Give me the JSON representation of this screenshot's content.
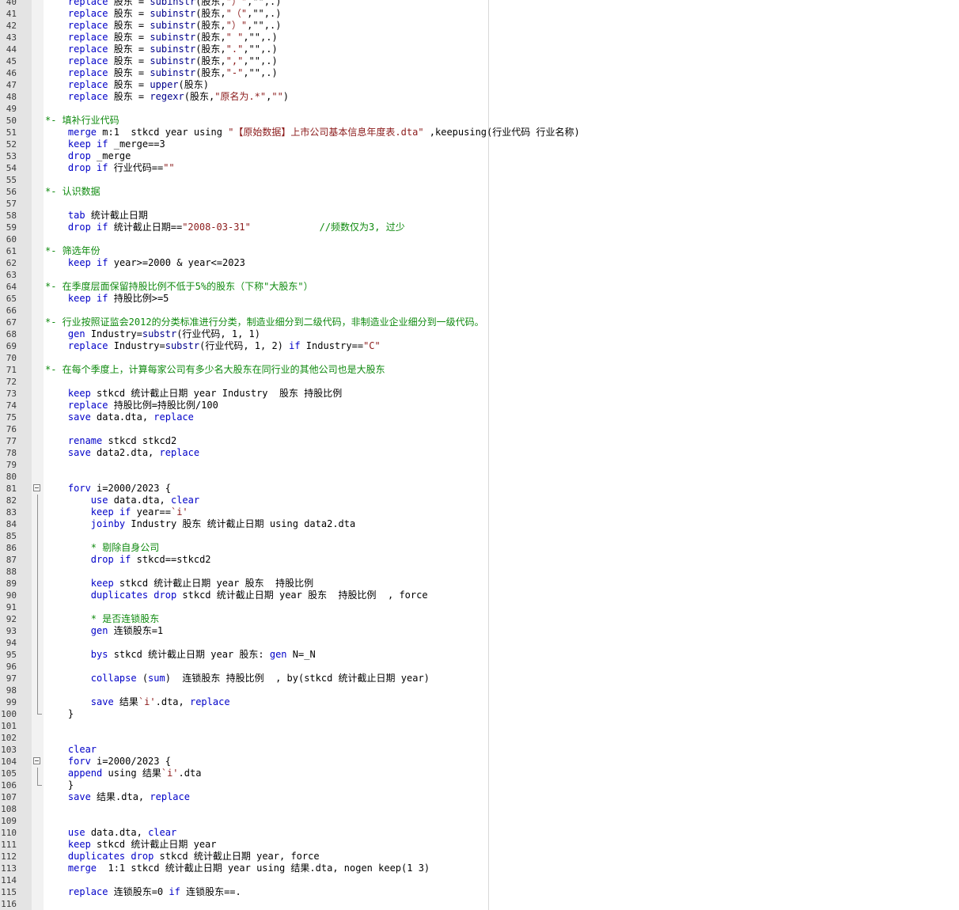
{
  "editor": {
    "colors": {
      "keyword": "#0000c8",
      "string": "#8b1a1a",
      "comment": "#0f8a0f",
      "function": "#00008b",
      "gutter_bg": "#e4e4e4"
    },
    "fold_markers": [
      81,
      104
    ],
    "lines": [
      {
        "n": "40",
        "segs": [
          [
            "    "
          ],
          [
            "replace",
            "kw"
          ],
          [
            " 股东 = "
          ],
          [
            "subinstr",
            "fn"
          ],
          [
            "(股东,"
          ],
          [
            "\"）\"",
            "str"
          ],
          [
            ",\"\",.)"
          ]
        ]
      },
      {
        "n": "41",
        "segs": [
          [
            "    "
          ],
          [
            "replace",
            "kw"
          ],
          [
            " 股东 = "
          ],
          [
            "subinstr",
            "fn"
          ],
          [
            "(股东,"
          ],
          [
            "\"（\"",
            "str"
          ],
          [
            ",\"\",.)"
          ]
        ]
      },
      {
        "n": "42",
        "segs": [
          [
            "    "
          ],
          [
            "replace",
            "kw"
          ],
          [
            " 股东 = "
          ],
          [
            "subinstr",
            "fn"
          ],
          [
            "(股东,"
          ],
          [
            "\"）\"",
            "str"
          ],
          [
            ",\"\",.)"
          ]
        ]
      },
      {
        "n": "43",
        "segs": [
          [
            "    "
          ],
          [
            "replace",
            "kw"
          ],
          [
            " 股东 = "
          ],
          [
            "subinstr",
            "fn"
          ],
          [
            "(股东,"
          ],
          [
            "\" \"",
            "str"
          ],
          [
            ",\"\",.)"
          ]
        ]
      },
      {
        "n": "44",
        "segs": [
          [
            "    "
          ],
          [
            "replace",
            "kw"
          ],
          [
            " 股东 = "
          ],
          [
            "subinstr",
            "fn"
          ],
          [
            "(股东,"
          ],
          [
            "\".\"",
            "str"
          ],
          [
            ",\"\",.)"
          ]
        ]
      },
      {
        "n": "45",
        "segs": [
          [
            "    "
          ],
          [
            "replace",
            "kw"
          ],
          [
            " 股东 = "
          ],
          [
            "subinstr",
            "fn"
          ],
          [
            "(股东,"
          ],
          [
            "\",\"",
            "str"
          ],
          [
            ",\"\",.)"
          ]
        ]
      },
      {
        "n": "46",
        "segs": [
          [
            "    "
          ],
          [
            "replace",
            "kw"
          ],
          [
            " 股东 = "
          ],
          [
            "subinstr",
            "fn"
          ],
          [
            "(股东,"
          ],
          [
            "\"-\"",
            "str"
          ],
          [
            ",\"\",.)"
          ]
        ]
      },
      {
        "n": "47",
        "segs": [
          [
            "    "
          ],
          [
            "replace",
            "kw"
          ],
          [
            " 股东 = "
          ],
          [
            "upper",
            "fn"
          ],
          [
            "(股东)"
          ]
        ]
      },
      {
        "n": "48",
        "segs": [
          [
            "    "
          ],
          [
            "replace",
            "kw"
          ],
          [
            " 股东 = "
          ],
          [
            "regexr",
            "fn"
          ],
          [
            "(股东,"
          ],
          [
            "\"原名为.*\"",
            "str"
          ],
          [
            ","
          ],
          [
            "\"\"",
            "str"
          ],
          [
            ")"
          ]
        ]
      },
      {
        "n": "49",
        "segs": []
      },
      {
        "n": "50",
        "segs": [
          [
            "*- 填补行业代码",
            "cm"
          ]
        ]
      },
      {
        "n": "51",
        "segs": [
          [
            "    "
          ],
          [
            "merge",
            "kw"
          ],
          [
            " m:1  stkcd year using "
          ],
          [
            "\"【原始数据】上市公司基本信息年度表.dta\"",
            "str"
          ],
          [
            " ,keepusing(行业代码 行业名称)"
          ]
        ]
      },
      {
        "n": "52",
        "segs": [
          [
            "    "
          ],
          [
            "keep",
            "kw"
          ],
          [
            " "
          ],
          [
            "if",
            "kw"
          ],
          [
            " _merge==3"
          ]
        ]
      },
      {
        "n": "53",
        "segs": [
          [
            "    "
          ],
          [
            "drop",
            "kw"
          ],
          [
            " _merge"
          ]
        ]
      },
      {
        "n": "54",
        "segs": [
          [
            "    "
          ],
          [
            "drop",
            "kw"
          ],
          [
            " "
          ],
          [
            "if",
            "kw"
          ],
          [
            " 行业代码=="
          ],
          [
            "\"\"",
            "str"
          ]
        ]
      },
      {
        "n": "55",
        "segs": []
      },
      {
        "n": "56",
        "segs": [
          [
            "*- 认识数据",
            "cm"
          ]
        ]
      },
      {
        "n": "57",
        "segs": []
      },
      {
        "n": "58",
        "segs": [
          [
            "    "
          ],
          [
            "tab",
            "kw"
          ],
          [
            " 统计截止日期"
          ]
        ]
      },
      {
        "n": "59",
        "segs": [
          [
            "    "
          ],
          [
            "drop",
            "kw"
          ],
          [
            " "
          ],
          [
            "if",
            "kw"
          ],
          [
            " 统计截止日期=="
          ],
          [
            "\"2008-03-31\"",
            "str"
          ],
          [
            "            "
          ],
          [
            "//频数仅为3, 过少",
            "cm"
          ]
        ]
      },
      {
        "n": "60",
        "segs": []
      },
      {
        "n": "61",
        "segs": [
          [
            "*- 筛选年份",
            "cm"
          ]
        ]
      },
      {
        "n": "62",
        "segs": [
          [
            "    "
          ],
          [
            "keep",
            "kw"
          ],
          [
            " "
          ],
          [
            "if",
            "kw"
          ],
          [
            " year>=2000 & year<=2023"
          ]
        ]
      },
      {
        "n": "63",
        "segs": []
      },
      {
        "n": "64",
        "segs": [
          [
            "*- 在季度层面保留持股比例不低于5%的股东（下称\"大股东\"）",
            "cm"
          ]
        ]
      },
      {
        "n": "65",
        "segs": [
          [
            "    "
          ],
          [
            "keep",
            "kw"
          ],
          [
            " "
          ],
          [
            "if",
            "kw"
          ],
          [
            " 持股比例>=5"
          ]
        ]
      },
      {
        "n": "66",
        "segs": []
      },
      {
        "n": "67",
        "segs": [
          [
            "*- 行业按照证监会2012的分类标准进行分类，制造业细分到二级代码，非制造业企业细分到一级代码。",
            "cm"
          ]
        ]
      },
      {
        "n": "68",
        "segs": [
          [
            "    "
          ],
          [
            "gen",
            "kw"
          ],
          [
            " Industry="
          ],
          [
            "substr",
            "fn"
          ],
          [
            "(行业代码, 1, 1)"
          ]
        ]
      },
      {
        "n": "69",
        "segs": [
          [
            "    "
          ],
          [
            "replace",
            "kw"
          ],
          [
            " Industry="
          ],
          [
            "substr",
            "fn"
          ],
          [
            "(行业代码, 1, 2) "
          ],
          [
            "if",
            "kw"
          ],
          [
            " Industry=="
          ],
          [
            "\"C\"",
            "str"
          ]
        ]
      },
      {
        "n": "70",
        "segs": []
      },
      {
        "n": "71",
        "segs": [
          [
            "*- 在每个季度上，计算每家公司有多少名大股东在同行业的其他公司也是大股东",
            "cm"
          ]
        ]
      },
      {
        "n": "72",
        "segs": []
      },
      {
        "n": "73",
        "segs": [
          [
            "    "
          ],
          [
            "keep",
            "kw"
          ],
          [
            " stkcd 统计截止日期 year Industry  股东 持股比例"
          ]
        ]
      },
      {
        "n": "74",
        "segs": [
          [
            "    "
          ],
          [
            "replace",
            "kw"
          ],
          [
            " 持股比例=持股比例/100"
          ]
        ]
      },
      {
        "n": "75",
        "segs": [
          [
            "    "
          ],
          [
            "save",
            "kw"
          ],
          [
            " data.dta, "
          ],
          [
            "replace",
            "kw"
          ]
        ]
      },
      {
        "n": "76",
        "segs": []
      },
      {
        "n": "77",
        "segs": [
          [
            "    "
          ],
          [
            "rename",
            "kw"
          ],
          [
            " stkcd stkcd2"
          ]
        ]
      },
      {
        "n": "78",
        "segs": [
          [
            "    "
          ],
          [
            "save",
            "kw"
          ],
          [
            " data2.dta, "
          ],
          [
            "replace",
            "kw"
          ]
        ]
      },
      {
        "n": "79",
        "segs": []
      },
      {
        "n": "80",
        "segs": []
      },
      {
        "n": "81",
        "segs": [
          [
            "    "
          ],
          [
            "forv",
            "kw"
          ],
          [
            " i=2000/2023 {"
          ]
        ]
      },
      {
        "n": "82",
        "segs": [
          [
            "        "
          ],
          [
            "use",
            "kw"
          ],
          [
            " data.dta, "
          ],
          [
            "clear",
            "kw"
          ]
        ]
      },
      {
        "n": "83",
        "segs": [
          [
            "        "
          ],
          [
            "keep",
            "kw"
          ],
          [
            " "
          ],
          [
            "if",
            "kw"
          ],
          [
            " year=="
          ],
          [
            "`i'",
            "str"
          ]
        ]
      },
      {
        "n": "84",
        "segs": [
          [
            "        "
          ],
          [
            "joinby",
            "kw"
          ],
          [
            " Industry 股东 统计截止日期 using data2.dta"
          ]
        ]
      },
      {
        "n": "85",
        "segs": []
      },
      {
        "n": "86",
        "segs": [
          [
            "        "
          ],
          [
            "* 剔除自身公司",
            "cm"
          ]
        ]
      },
      {
        "n": "87",
        "segs": [
          [
            "        "
          ],
          [
            "drop",
            "kw"
          ],
          [
            " "
          ],
          [
            "if",
            "kw"
          ],
          [
            " stkcd==stkcd2"
          ]
        ]
      },
      {
        "n": "88",
        "segs": []
      },
      {
        "n": "89",
        "segs": [
          [
            "        "
          ],
          [
            "keep",
            "kw"
          ],
          [
            " stkcd 统计截止日期 year 股东  持股比例"
          ]
        ]
      },
      {
        "n": "90",
        "segs": [
          [
            "        "
          ],
          [
            "duplicates",
            "kw"
          ],
          [
            " "
          ],
          [
            "drop",
            "kw"
          ],
          [
            " stkcd 统计截止日期 year 股东  持股比例  , force"
          ]
        ]
      },
      {
        "n": "91",
        "segs": []
      },
      {
        "n": "92",
        "segs": [
          [
            "        "
          ],
          [
            "* 是否连锁股东",
            "cm"
          ]
        ]
      },
      {
        "n": "93",
        "segs": [
          [
            "        "
          ],
          [
            "gen",
            "kw"
          ],
          [
            " 连锁股东=1"
          ]
        ]
      },
      {
        "n": "94",
        "segs": []
      },
      {
        "n": "95",
        "segs": [
          [
            "        "
          ],
          [
            "bys",
            "kw"
          ],
          [
            " stkcd 统计截止日期 year 股东: "
          ],
          [
            "gen",
            "kw"
          ],
          [
            " N=_N"
          ]
        ]
      },
      {
        "n": "96",
        "segs": []
      },
      {
        "n": "97",
        "segs": [
          [
            "        "
          ],
          [
            "collapse",
            "kw"
          ],
          [
            " ("
          ],
          [
            "sum",
            "kw"
          ],
          [
            ")  连锁股东 持股比例  , by(stkcd 统计截止日期 year)"
          ]
        ]
      },
      {
        "n": "98",
        "segs": []
      },
      {
        "n": "99",
        "segs": [
          [
            "        "
          ],
          [
            "save",
            "kw"
          ],
          [
            " 结果"
          ],
          [
            "`i'",
            "str"
          ],
          [
            ".dta, "
          ],
          [
            "replace",
            "kw"
          ]
        ]
      },
      {
        "n": "100",
        "segs": [
          [
            "    }"
          ]
        ]
      },
      {
        "n": "101",
        "segs": []
      },
      {
        "n": "102",
        "segs": []
      },
      {
        "n": "103",
        "segs": [
          [
            "    "
          ],
          [
            "clear",
            "kw"
          ]
        ]
      },
      {
        "n": "104",
        "segs": [
          [
            "    "
          ],
          [
            "forv",
            "kw"
          ],
          [
            " i=2000/2023 {"
          ]
        ]
      },
      {
        "n": "105",
        "segs": [
          [
            "    "
          ],
          [
            "append",
            "kw"
          ],
          [
            " using 结果"
          ],
          [
            "`i'",
            "str"
          ],
          [
            ".dta"
          ]
        ]
      },
      {
        "n": "106",
        "segs": [
          [
            "    }"
          ]
        ]
      },
      {
        "n": "107",
        "segs": [
          [
            "    "
          ],
          [
            "save",
            "kw"
          ],
          [
            " 结果.dta, "
          ],
          [
            "replace",
            "kw"
          ]
        ]
      },
      {
        "n": "108",
        "segs": []
      },
      {
        "n": "109",
        "segs": []
      },
      {
        "n": "110",
        "segs": [
          [
            "    "
          ],
          [
            "use",
            "kw"
          ],
          [
            " data.dta, "
          ],
          [
            "clear",
            "kw"
          ]
        ]
      },
      {
        "n": "111",
        "segs": [
          [
            "    "
          ],
          [
            "keep",
            "kw"
          ],
          [
            " stkcd 统计截止日期 year"
          ]
        ]
      },
      {
        "n": "112",
        "segs": [
          [
            "    "
          ],
          [
            "duplicates",
            "kw"
          ],
          [
            " "
          ],
          [
            "drop",
            "kw"
          ],
          [
            " stkcd 统计截止日期 year, force"
          ]
        ]
      },
      {
        "n": "113",
        "segs": [
          [
            "    "
          ],
          [
            "merge",
            "kw"
          ],
          [
            "  1:1 stkcd 统计截止日期 year using 结果.dta, nogen keep(1 3)"
          ]
        ]
      },
      {
        "n": "114",
        "segs": []
      },
      {
        "n": "115",
        "segs": [
          [
            "    "
          ],
          [
            "replace",
            "kw"
          ],
          [
            " 连锁股东=0 "
          ],
          [
            "if",
            "kw"
          ],
          [
            " 连锁股东==."
          ]
        ]
      },
      {
        "n": "116",
        "segs": []
      }
    ]
  }
}
